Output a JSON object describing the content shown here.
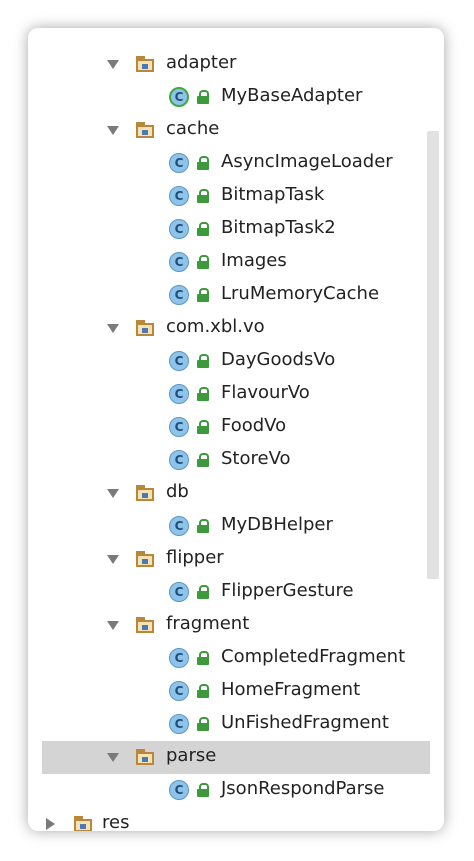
{
  "tree": {
    "nodes": [
      {
        "kind": "folder",
        "label": "adapter",
        "expanded": true
      },
      {
        "kind": "class",
        "label": "MyBaseAdapter",
        "variant": "green"
      },
      {
        "kind": "folder",
        "label": "cache",
        "expanded": true
      },
      {
        "kind": "class",
        "label": "AsyncImageLoader"
      },
      {
        "kind": "class",
        "label": "BitmapTask"
      },
      {
        "kind": "class",
        "label": "BitmapTask2"
      },
      {
        "kind": "class",
        "label": "Images"
      },
      {
        "kind": "class",
        "label": "LruMemoryCache"
      },
      {
        "kind": "folder",
        "label": "com.xbl.vo",
        "expanded": true
      },
      {
        "kind": "class",
        "label": "DayGoodsVo"
      },
      {
        "kind": "class",
        "label": "FlavourVo"
      },
      {
        "kind": "class",
        "label": "FoodVo"
      },
      {
        "kind": "class",
        "label": "StoreVo"
      },
      {
        "kind": "folder",
        "label": "db",
        "expanded": true
      },
      {
        "kind": "class",
        "label": "MyDBHelper"
      },
      {
        "kind": "folder",
        "label": "flipper",
        "expanded": true
      },
      {
        "kind": "class",
        "label": "FlipperGesture"
      },
      {
        "kind": "folder",
        "label": "fragment",
        "expanded": true
      },
      {
        "kind": "class",
        "label": "CompletedFragment"
      },
      {
        "kind": "class",
        "label": "HomeFragment"
      },
      {
        "kind": "class",
        "label": "UnFishedFragment"
      },
      {
        "kind": "folder",
        "label": "parse",
        "expanded": true,
        "selected": true
      },
      {
        "kind": "class",
        "label": "JsonRespondParse"
      },
      {
        "kind": "folder",
        "label": "res",
        "expanded": false,
        "partial": true
      }
    ],
    "class_glyph": "C",
    "icons": {
      "folder": "package-folder-icon",
      "class": "java-class-icon",
      "access": "public-lock-icon",
      "toggle": "tree-toggle-icon"
    }
  },
  "colors": {
    "selection": "#d4d4d4",
    "folder": "#b8873c",
    "class_icon": "#8ec3ea",
    "access": "#3c9a3c"
  }
}
